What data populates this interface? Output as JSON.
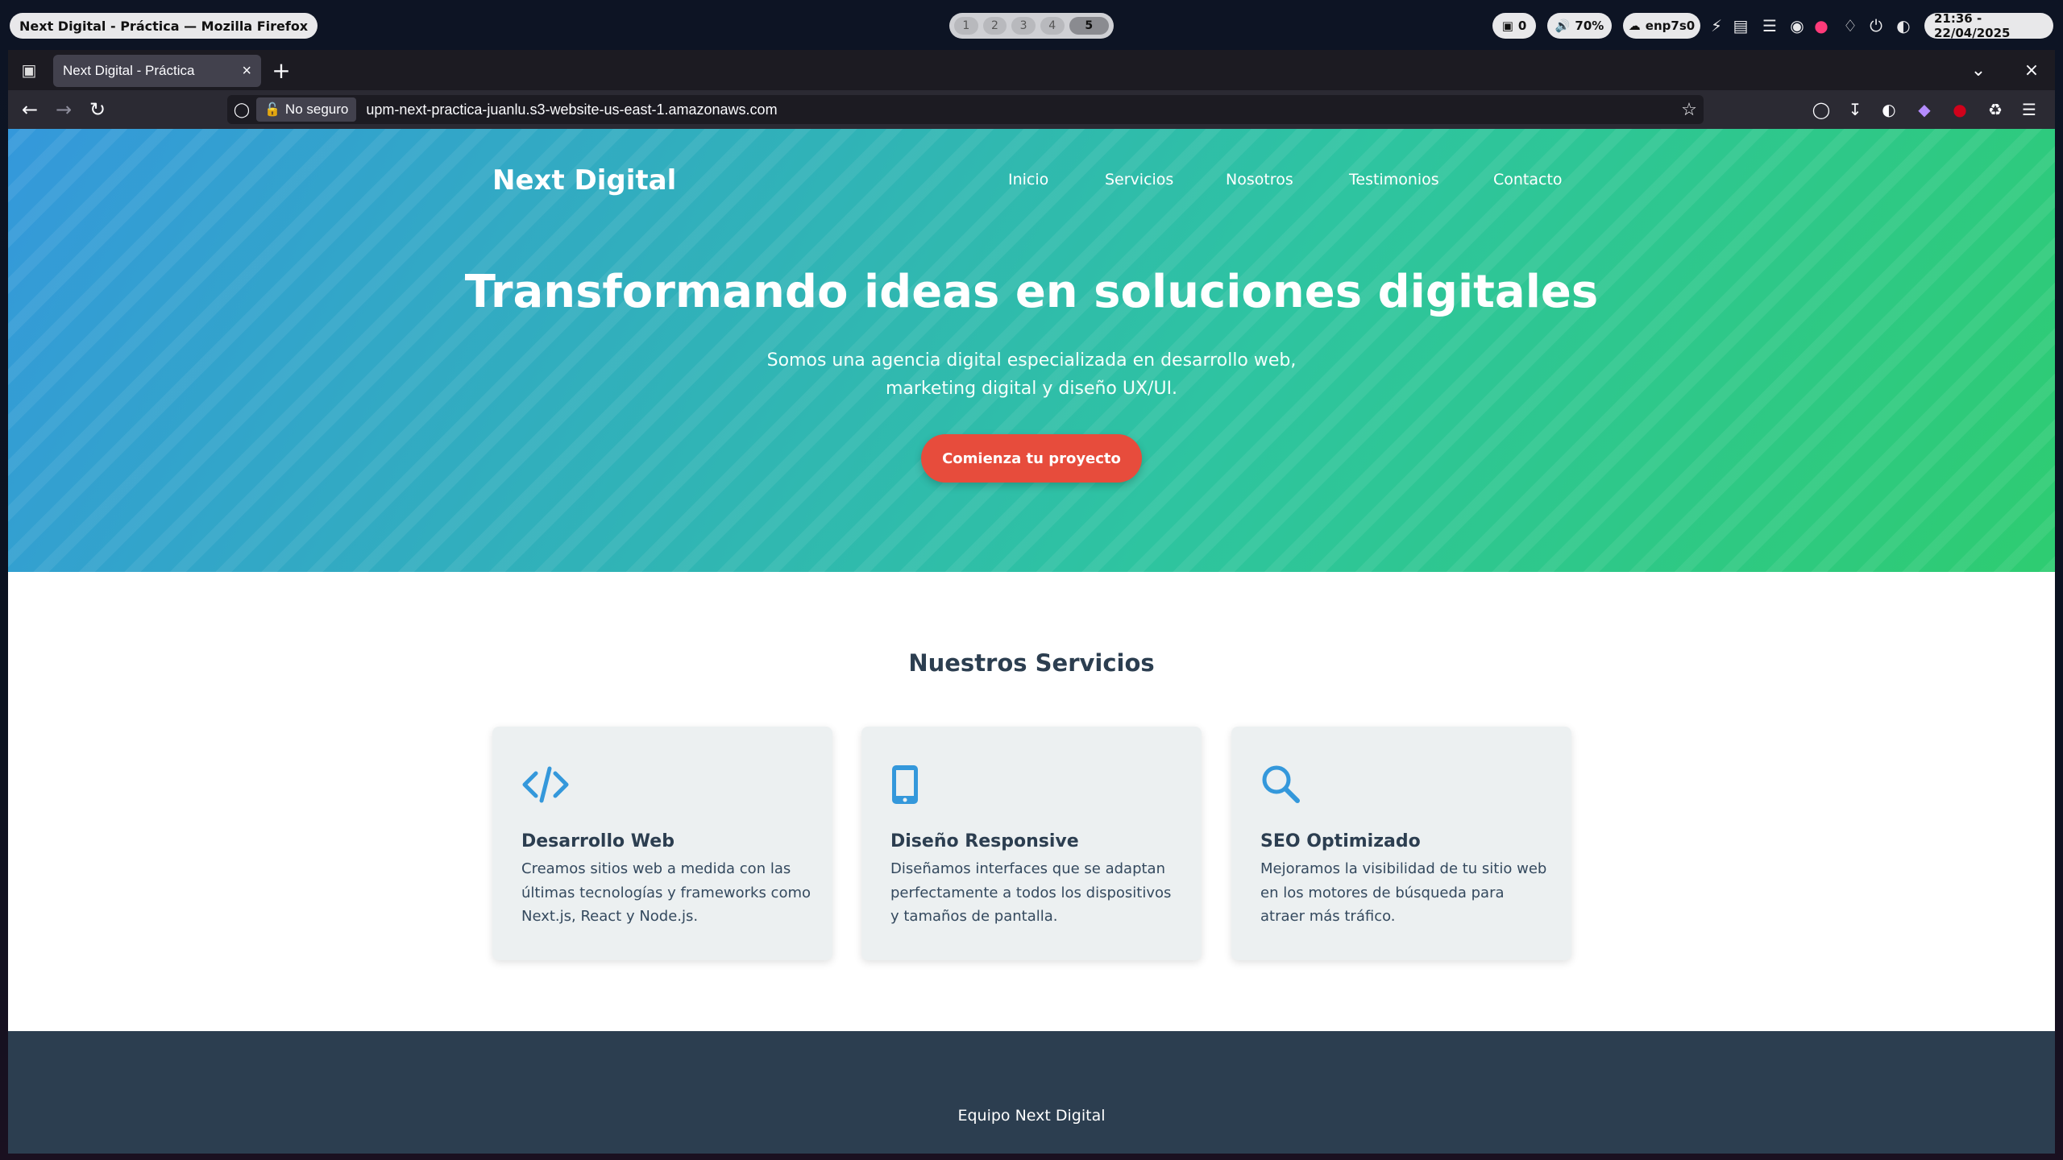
{
  "system_bar": {
    "window_title": "Next Digital - Práctica — Mozilla Firefox",
    "workspaces": [
      "1",
      "2",
      "3",
      "4",
      "5"
    ],
    "active_workspace": "5",
    "notifications_count": "0",
    "volume": "70%",
    "network": "enp7s0",
    "datetime": "21:36 - 22/04/2025"
  },
  "browser": {
    "tab_title": "Next Digital - Práctica",
    "security_label": "No seguro",
    "url": "upm-next-practica-juanlu.s3-website-us-east-1.amazonaws.com"
  },
  "site": {
    "brand": "Next Digital",
    "nav": [
      "Inicio",
      "Servicios",
      "Nosotros",
      "Testimonios",
      "Contacto"
    ],
    "hero": {
      "title": "Transformando ideas en soluciones digitales",
      "subtitle": "Somos una agencia digital especializada en desarrollo web, marketing digital y diseño UX/UI.",
      "cta": "Comienza tu proyecto"
    },
    "services_title": "Nuestros Servicios",
    "services": [
      {
        "icon": "code-icon",
        "title": "Desarrollo Web",
        "text": "Creamos sitios web a medida con las últimas tecnologías y frameworks como Next.js, React y Node.js."
      },
      {
        "icon": "mobile-icon",
        "title": "Diseño Responsive",
        "text": "Diseñamos interfaces que se adaptan perfectamente a todos los dispositivos y tamaños de pantalla."
      },
      {
        "icon": "search-icon",
        "title": "SEO Optimizado",
        "text": "Mejoramos la visibilidad de tu sitio web en los motores de búsqueda para atraer más tráfico."
      }
    ],
    "footer": "Equipo Next Digital"
  },
  "colors": {
    "accent_blue": "#3498db",
    "accent_green": "#2ecc71",
    "cta_red": "#e74c3c",
    "dark_navy": "#2c3e50"
  }
}
